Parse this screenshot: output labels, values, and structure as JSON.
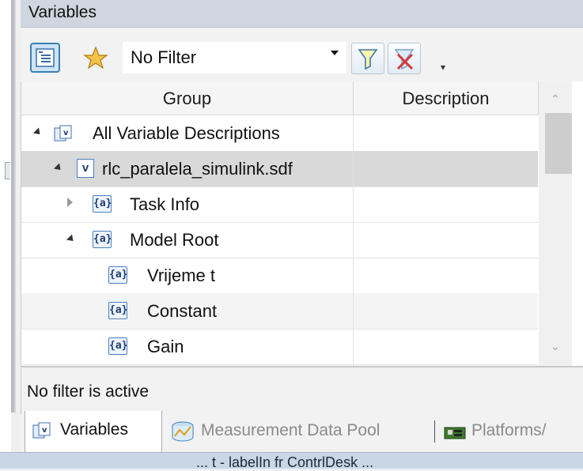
{
  "panel": {
    "title": "Variables"
  },
  "toolbar": {
    "filter_value": "No Filter",
    "overflow_glyph": "▾"
  },
  "grid": {
    "columns": [
      "Group",
      "Description"
    ],
    "rows": [
      {
        "label": "All Variable Descriptions",
        "icon": "variable-group-icon",
        "expander": "expanded"
      },
      {
        "label": "rlc_paralela_simulink.sdf",
        "icon": "variable-file-icon",
        "expander": "expanded",
        "selected": true
      },
      {
        "label": "Task Info",
        "icon": "variable-block-icon",
        "expander": "collapsed"
      },
      {
        "label": "Model Root",
        "icon": "variable-block-icon",
        "expander": "expanded"
      },
      {
        "label": "Vrijeme t",
        "icon": "variable-block-icon",
        "expander": "none"
      },
      {
        "label": "Constant",
        "icon": "variable-block-icon",
        "expander": "none"
      },
      {
        "label": "Gain",
        "icon": "variable-block-icon",
        "expander": "none"
      }
    ],
    "icon_a_text": "{a}",
    "icon_v_text": "v"
  },
  "status": {
    "text": "No filter is active"
  },
  "tabs": [
    {
      "label": "Variables",
      "icon": "variables-tab-icon",
      "active": true
    },
    {
      "label": "Measurement Data Pool",
      "icon": "measurement-data-pool-icon",
      "active": false
    },
    {
      "label": "Platforms/",
      "icon": "platforms-icon",
      "active": false
    }
  ],
  "bottom": {
    "text": "... t - labelIn fr  ContrlDesk ..."
  },
  "colors": {
    "selected_row": "#d9d9d9",
    "title_bar": "#cfd6e0",
    "accent": "#3c7fb1"
  }
}
